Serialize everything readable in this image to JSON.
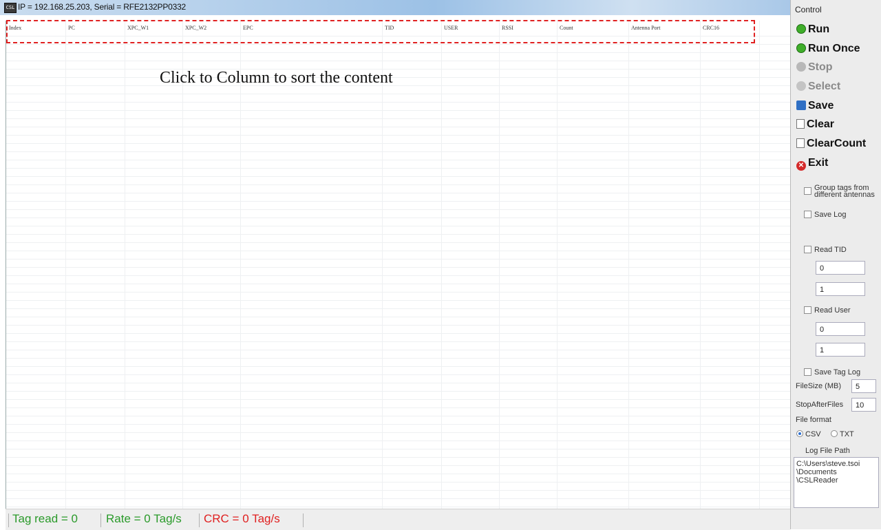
{
  "window": {
    "title": "IP = 192.168.25.203, Serial = RFE2132PP0332",
    "icon": "app-icon"
  },
  "table": {
    "columns": [
      "Index",
      "PC",
      "XPC_W1",
      "XPC_W2",
      "EPC",
      "TID",
      "USER",
      "RSSI",
      "Count",
      "Antenna Port",
      "CRC16"
    ]
  },
  "annotation": {
    "hint": "Click to Column to sort the content"
  },
  "status": {
    "tag_read": "Tag read = 0",
    "rate": "Rate = 0 Tag/s",
    "crc": "CRC = 0 Tag/s",
    "colors": {
      "tag_read": "#2a9a2a",
      "rate": "#2a9a2a",
      "crc": "#e02020"
    }
  },
  "control": {
    "title": "Control",
    "buttons": {
      "run": "Run",
      "run_once": "Run Once",
      "stop": "Stop",
      "select": "Select",
      "save": "Save",
      "clear": "Clear",
      "clear_count": "ClearCount",
      "exit": "Exit"
    },
    "group_tags": "Group tags from different antennas",
    "save_log": "Save Log",
    "read_tid": "Read TID",
    "tid_offset": "0",
    "tid_length": "1",
    "read_user": "Read User",
    "user_offset": "0",
    "user_length": "1",
    "save_tag_log": "Save Tag Log",
    "file_size_label": "FileSize (MB)",
    "file_size": "5",
    "stop_after_label": "StopAfterFiles",
    "stop_after": "10",
    "file_format_label": "File format",
    "format_csv": "CSV",
    "format_txt": "TXT",
    "log_path_button": "Log File Path",
    "log_path": "C:\\Users\\steve.tsoi\n\\Documents\n\\CSLReader"
  }
}
